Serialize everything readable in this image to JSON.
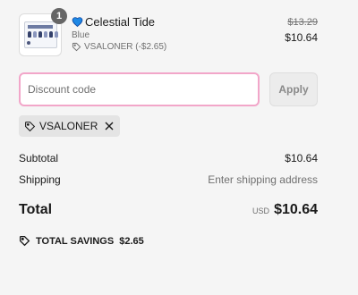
{
  "line_item": {
    "quantity": "1",
    "title": "Celestial Tide",
    "variant": "Blue",
    "discount_label": "VSALONER (-$2.65)",
    "original_price": "$13.29",
    "price": "$10.64"
  },
  "discount": {
    "placeholder": "Discount code",
    "apply_label": "Apply",
    "applied_code": "VSALONER"
  },
  "summary": {
    "subtotal_label": "Subtotal",
    "subtotal_value": "$10.64",
    "shipping_label": "Shipping",
    "shipping_value": "Enter shipping address",
    "total_label": "Total",
    "currency": "USD",
    "total_value": "$10.64",
    "savings_label": "TOTAL SAVINGS",
    "savings_value": "$2.65"
  },
  "colors": {
    "input_border": "#f2a6c9",
    "heart": "#1e88e5"
  }
}
